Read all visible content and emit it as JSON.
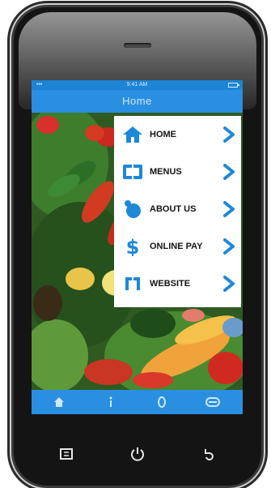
{
  "app": {
    "title": "Home",
    "status_time": "9:41 AM",
    "status_carrier": "•••"
  },
  "menu": {
    "items": [
      {
        "label": "HOME",
        "icon": "home-icon"
      },
      {
        "label": "MENUS",
        "icon": "menus-icon"
      },
      {
        "label": "ABOUT US",
        "icon": "about-icon"
      },
      {
        "label": "ONLINE PAY",
        "icon": "dollar-icon"
      },
      {
        "label": "WEBSITE",
        "icon": "website-icon"
      }
    ]
  },
  "tabbar": {
    "tabs": [
      {
        "icon": "home-tab-icon"
      },
      {
        "icon": "info-tab-icon"
      },
      {
        "icon": "location-tab-icon"
      },
      {
        "icon": "message-tab-icon"
      }
    ]
  },
  "hardware_buttons": [
    {
      "icon": "menu-hardware-icon"
    },
    {
      "icon": "power-icon"
    },
    {
      "icon": "back-icon"
    }
  ],
  "colors": {
    "accent": "#2a8fe0",
    "icon_blue": "#1e88d8",
    "menu_bg": "#ffffff",
    "label": "#151515"
  }
}
